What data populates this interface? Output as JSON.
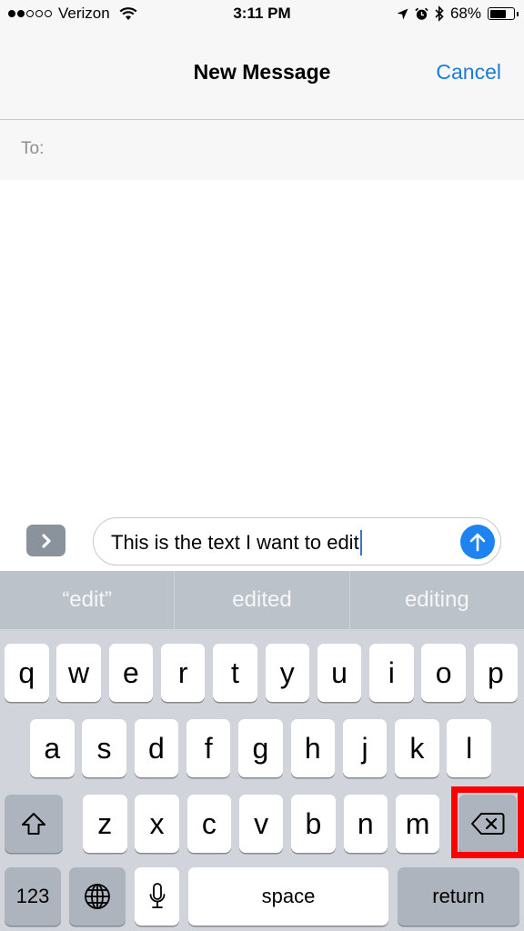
{
  "status_bar": {
    "signal_bars_filled": 2,
    "signal_bars_total": 5,
    "carrier": "Verizon",
    "time": "3:11 PM",
    "icons": [
      "wifi-icon",
      "location-arrow-icon",
      "alarm-icon",
      "bluetooth-icon",
      "battery-icon"
    ],
    "battery_percent_label": "68%",
    "battery_level": 0.68
  },
  "nav": {
    "title": "New Message",
    "cancel_label": "Cancel"
  },
  "recipient": {
    "label": "To:",
    "value": ""
  },
  "compose": {
    "expand_icon": "chevron-right-icon",
    "text": "This is the text I want to edit",
    "send_icon": "arrow-up-icon"
  },
  "keyboard": {
    "suggestions": [
      "“edit”",
      "edited",
      "editing"
    ],
    "row1": [
      "q",
      "w",
      "e",
      "r",
      "t",
      "y",
      "u",
      "i",
      "o",
      "p"
    ],
    "row2": [
      "a",
      "s",
      "d",
      "f",
      "g",
      "h",
      "j",
      "k",
      "l"
    ],
    "row3": [
      "z",
      "x",
      "c",
      "v",
      "b",
      "n",
      "m"
    ],
    "shift_icon": "shift-icon",
    "delete_icon": "backspace-icon",
    "numbers_label": "123",
    "globe_icon": "globe-icon",
    "mic_icon": "microphone-icon",
    "space_label": "space",
    "return_label": "return"
  },
  "annotation": {
    "highlighted_key": "delete",
    "highlight_color": "#ff0000"
  },
  "colors": {
    "accent": "#1c7cd8",
    "send_button": "#1e83f0",
    "keyboard_bg": "#d1d5db",
    "suggestion_bar": "#bcc2ca",
    "function_key": "#aeb4bd"
  }
}
